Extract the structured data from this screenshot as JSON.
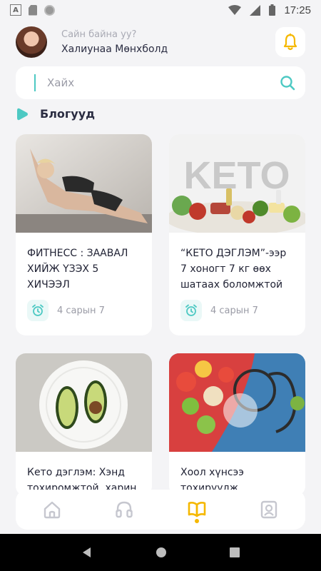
{
  "status_bar": {
    "time": "17:25"
  },
  "header": {
    "greeting": "Сайн байна уу?",
    "username": "Халиунаа Мөнхболд"
  },
  "search": {
    "placeholder": "Хайх"
  },
  "section": {
    "title": "Блогууд"
  },
  "cards": [
    {
      "title": "ФИТНЕСС : ЗААВАЛ ХИЙЖ ҮЗЭХ 5 ХИЧЭЭЛ",
      "date": "4 сарын 7"
    },
    {
      "title": "“КЕТО ДЭГЛЭМ”-ээр 7 хоногт 7 кг өөх шатаах боломжтой",
      "date": "4 сарын 7",
      "image_text": "KETO"
    },
    {
      "title": "Кето дэглэм: Хэнд тохиромжтой, харин",
      "date": ""
    },
    {
      "title": "Хоол хүнсээ тохируулж харгалзах",
      "date": ""
    }
  ],
  "colors": {
    "accent": "#4dc9c3",
    "bell": "#f5b800",
    "active_nav": "#f5b800"
  },
  "bottom_nav": [
    {
      "icon": "home-icon"
    },
    {
      "icon": "headphones-icon"
    },
    {
      "icon": "book-icon",
      "active": true
    },
    {
      "icon": "profile-icon"
    }
  ]
}
